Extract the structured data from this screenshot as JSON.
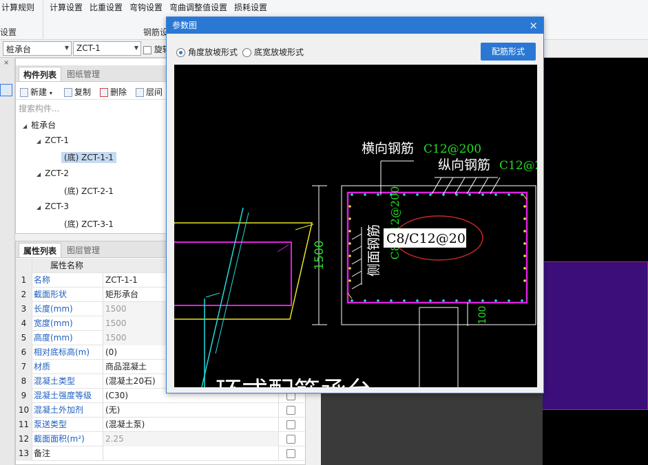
{
  "ribbon": {
    "items": [
      "计算规则",
      "计算设置",
      "比重设置",
      "弯钩设置",
      "弯曲调整值设置",
      "损耗设置"
    ],
    "groups": [
      "设置",
      "钢筋设"
    ]
  },
  "selector": {
    "category": "桩承台",
    "component": "ZCT-1",
    "checkbox_label": "旋转"
  },
  "component_panel": {
    "tabs": [
      "构件列表",
      "图纸管理"
    ],
    "toolbar": [
      "新建",
      "复制",
      "删除",
      "层间"
    ],
    "search_placeholder": "搜索构件...",
    "tree": {
      "root": "桩承台",
      "groups": [
        {
          "name": "ZCT-1",
          "child": "(底)  ZCT-1-1"
        },
        {
          "name": "ZCT-2",
          "child": "(底)  ZCT-2-1"
        },
        {
          "name": "ZCT-3",
          "child": "(底)  ZCT-3-1"
        }
      ]
    }
  },
  "property_panel": {
    "tabs": [
      "属性列表",
      "图层管理"
    ],
    "header_name": "属性名称",
    "rows": [
      {
        "num": "1",
        "name": "名称",
        "value": "ZCT-1-1"
      },
      {
        "num": "2",
        "name": "截面形状",
        "value": "矩形承台"
      },
      {
        "num": "3",
        "name": "长度(mm)",
        "value": "1500"
      },
      {
        "num": "4",
        "name": "宽度(mm)",
        "value": "1500"
      },
      {
        "num": "5",
        "name": "高度(mm)",
        "value": "1500"
      },
      {
        "num": "6",
        "name": "相对底标高(m)",
        "value": "(0)"
      },
      {
        "num": "7",
        "name": "材质",
        "value": "商品混凝土"
      },
      {
        "num": "8",
        "name": "混凝土类型",
        "value": "(混凝土20石)"
      },
      {
        "num": "9",
        "name": "混凝土强度等级",
        "value": "(C30)"
      },
      {
        "num": "10",
        "name": "混凝土外加剂",
        "value": "(无)"
      },
      {
        "num": "11",
        "name": "泵送类型",
        "value": "(混凝土泵)"
      },
      {
        "num": "12",
        "name": "截面面积(m²)",
        "value": "2.25"
      },
      {
        "num": "13",
        "name": "备注",
        "value": ""
      }
    ]
  },
  "dialog": {
    "title": "参数图",
    "close": "×",
    "radio_angle": "角度放坡形式",
    "radio_width": "底宽放坡形式",
    "rebar_button": "配筋形式",
    "drawing": {
      "horizontal_label": "横向钢筋",
      "horizontal_value": "C12@200",
      "longitudinal_label": "纵向钢筋",
      "longitudinal_value": "C12@2",
      "side_label": "侧面钢筋",
      "side_value_box": "C8/C12@200",
      "side_value_vertical": "C8/C12@200",
      "dim_height": "1500",
      "dim_cover": "100",
      "bottom_text": "环式配筋承台"
    }
  },
  "colors": {
    "accent": "#2b78d4",
    "rebar_magenta": "#e020e0",
    "rebar_green": "#22dd22",
    "cyan": "#22dddd",
    "yellow": "#e8e822"
  }
}
